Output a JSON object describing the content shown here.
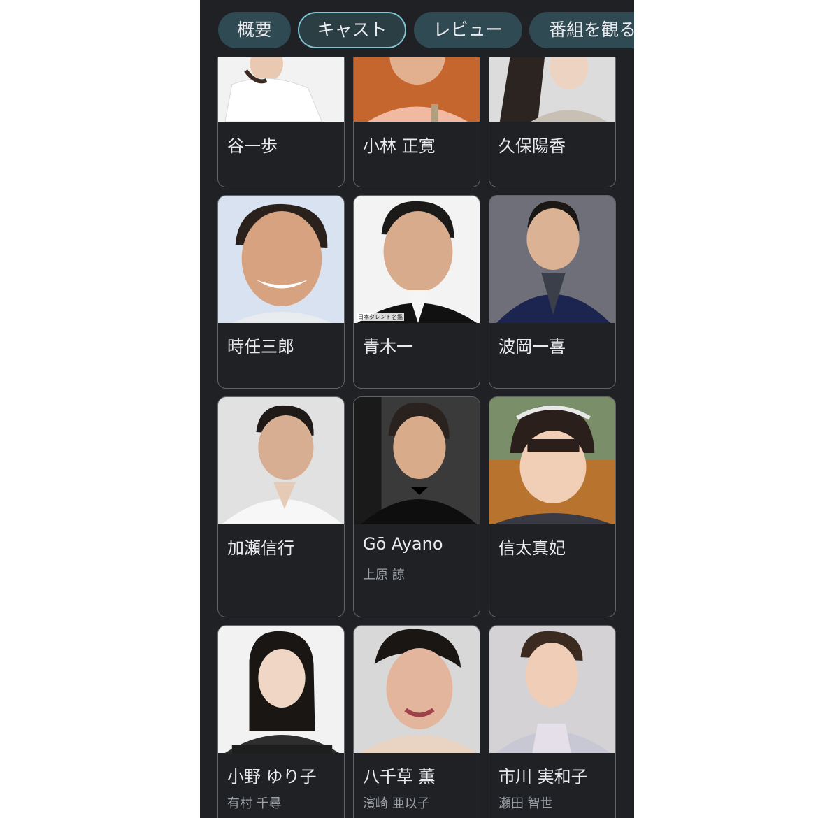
{
  "tabs": [
    {
      "label": "概要"
    },
    {
      "label": "キャスト"
    },
    {
      "label": "レビュー"
    },
    {
      "label": "番組を観る"
    }
  ],
  "active_tab_index": 1,
  "cast": [
    {
      "name": "谷一歩",
      "role": ""
    },
    {
      "name": "小林 正寛",
      "role": ""
    },
    {
      "name": "久保陽香",
      "role": ""
    },
    {
      "name": "時任三郎",
      "role": ""
    },
    {
      "name": "青木一",
      "role": ""
    },
    {
      "name": "波岡一喜",
      "role": ""
    },
    {
      "name": "加瀬信行",
      "role": ""
    },
    {
      "name": "Gō Ayano",
      "role": "上原 諒"
    },
    {
      "name": "信太真妃",
      "role": ""
    },
    {
      "name": "小野 ゆり子",
      "role": "有村 千尋"
    },
    {
      "name": "八千草 薫",
      "role": "濱崎 亜以子"
    },
    {
      "name": "市川 実和子",
      "role": "瀬田 智世"
    }
  ],
  "photo_watermark": "日本タレント名鑑",
  "colors": {
    "background": "#202124",
    "chip": "#2f4a52",
    "chip_active_border": "#7fc7d4",
    "text": "#e8eaed",
    "subtext": "#9aa0a6",
    "card_border": "#5f6368"
  }
}
